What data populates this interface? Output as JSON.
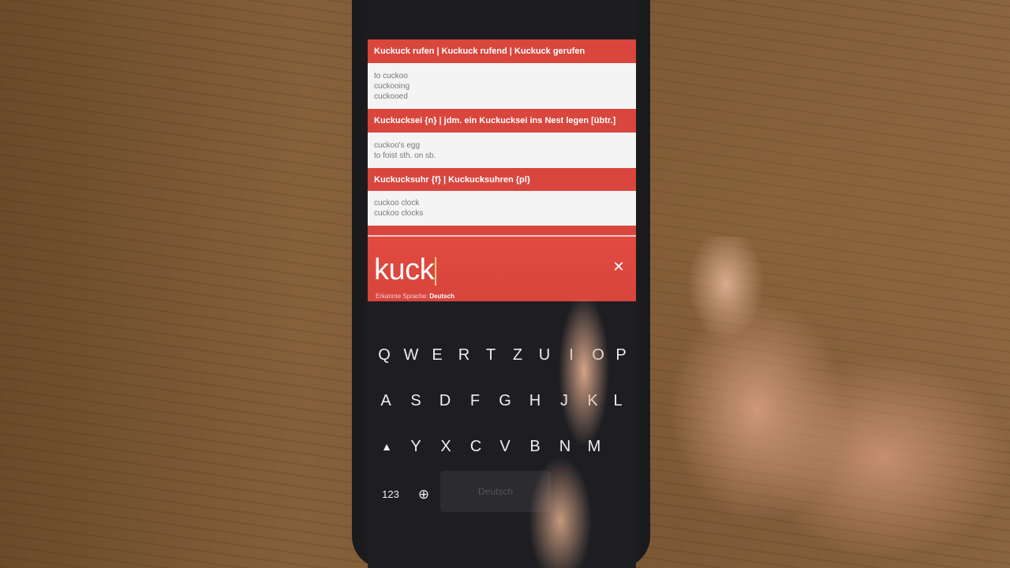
{
  "results": [
    {
      "heading": "Kuckuck rufen | Kuckuck rufend | Kuckuck gerufen",
      "translations": [
        "to cuckoo",
        "cuckooing",
        "cuckooed"
      ]
    },
    {
      "heading": "Kuckucksei {n} | jdm. ein Kuckucksei ins Nest legen [übtr.]",
      "translations": [
        "cuckoo's egg",
        "to foist sth. on sb."
      ]
    },
    {
      "heading": "Kuckucksuhr {f} | Kuckucksuhren {pl}",
      "translations": [
        "cuckoo clock",
        "cuckoo clocks"
      ]
    }
  ],
  "search": {
    "query": "kuck",
    "detected_label": "Erkannte Sprache:",
    "detected_language": "Deutsch",
    "clear_icon": "close-icon"
  },
  "keyboard": {
    "row1": [
      "Q",
      "W",
      "E",
      "R",
      "T",
      "Z",
      "U",
      "I",
      "O",
      "P"
    ],
    "row2": [
      "A",
      "S",
      "D",
      "F",
      "G",
      "H",
      "J",
      "K",
      "L"
    ],
    "row3": [
      "Y",
      "X",
      "C",
      "V",
      "B",
      "N",
      "M"
    ],
    "numbers_label": "123",
    "space_label": "Deutsch",
    "shift_icon": "shift-icon",
    "globe_icon": "globe-icon"
  },
  "colors": {
    "accent": "#d9463e",
    "result_bg": "#f4f4f4",
    "keyboard_bg": "#1e1e22"
  }
}
